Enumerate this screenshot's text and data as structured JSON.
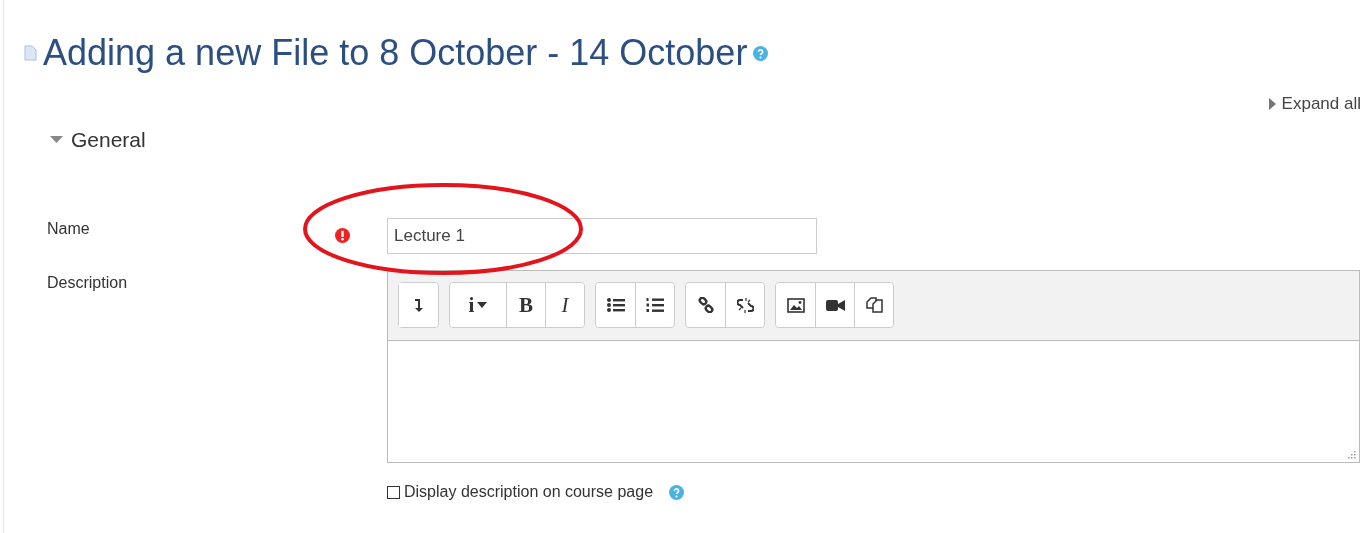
{
  "heading": {
    "title": "Adding a new File to 8 October - 14 October"
  },
  "expand_all": "Expand all",
  "section": {
    "title": "General",
    "expanded": true
  },
  "name_field": {
    "label": "Name",
    "value": "Lecture 1",
    "required": true
  },
  "description": {
    "label": "Description",
    "toolbar": [
      [
        {
          "kind": "insert"
        }
      ],
      [
        {
          "kind": "menu",
          "label": "i"
        },
        {
          "kind": "bold",
          "label": "B"
        },
        {
          "kind": "italic",
          "label": "I"
        }
      ],
      [
        {
          "kind": "bullets"
        },
        {
          "kind": "numbers"
        }
      ],
      [
        {
          "kind": "link"
        },
        {
          "kind": "unlink"
        }
      ],
      [
        {
          "kind": "image"
        },
        {
          "kind": "video"
        },
        {
          "kind": "copy"
        }
      ]
    ]
  },
  "display_option": {
    "label": "Display description on course page",
    "checked": false
  },
  "annotation": {
    "kind": "ellipse"
  }
}
